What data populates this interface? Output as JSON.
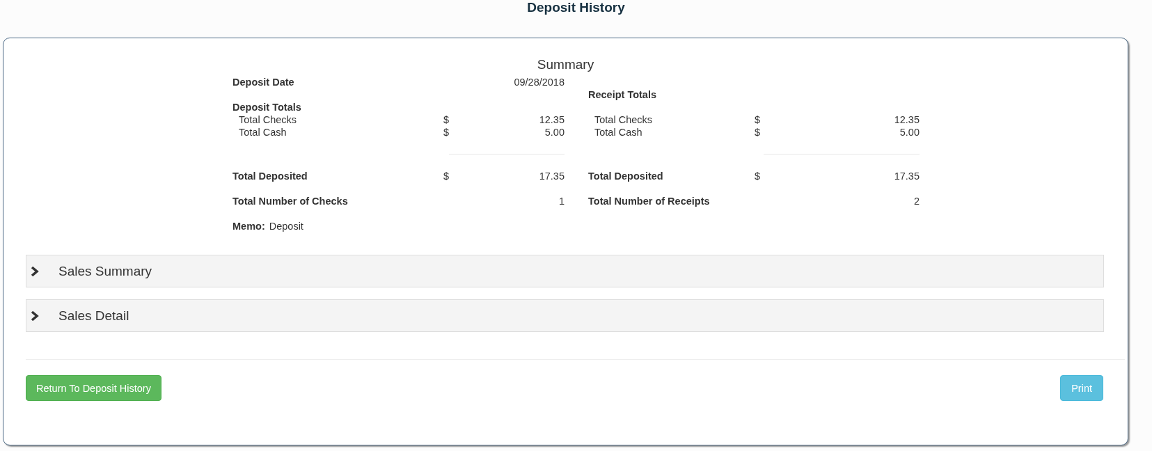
{
  "page_title": "Deposit History",
  "summary": {
    "title": "Summary",
    "left": {
      "date_label": "Deposit Date",
      "date_value": "09/28/2018",
      "totals_heading": "Deposit Totals",
      "lines": [
        {
          "label": "Total Checks",
          "currency": "$",
          "amount": "12.35"
        },
        {
          "label": "Total Cash",
          "currency": "$",
          "amount": "5.00"
        }
      ],
      "total": {
        "label": "Total Deposited",
        "currency": "$",
        "amount": "17.35"
      },
      "count": {
        "label": "Total Number of Checks",
        "value": "1"
      },
      "memo": {
        "label": "Memo:",
        "value": "Deposit"
      }
    },
    "right": {
      "totals_heading": "Receipt Totals",
      "lines": [
        {
          "label": "Total Checks",
          "currency": "$",
          "amount": "12.35"
        },
        {
          "label": "Total Cash",
          "currency": "$",
          "amount": "5.00"
        }
      ],
      "total": {
        "label": "Total Deposited",
        "currency": "$",
        "amount": "17.35"
      },
      "count": {
        "label": "Total Number of Receipts",
        "value": "2"
      }
    }
  },
  "sections": [
    {
      "title": "Sales Summary",
      "expanded": false
    },
    {
      "title": "Sales Detail",
      "expanded": false
    }
  ],
  "buttons": [
    {
      "label": "Return To Deposit History",
      "kind": "success"
    },
    {
      "label": "Print",
      "kind": "info"
    }
  ]
}
